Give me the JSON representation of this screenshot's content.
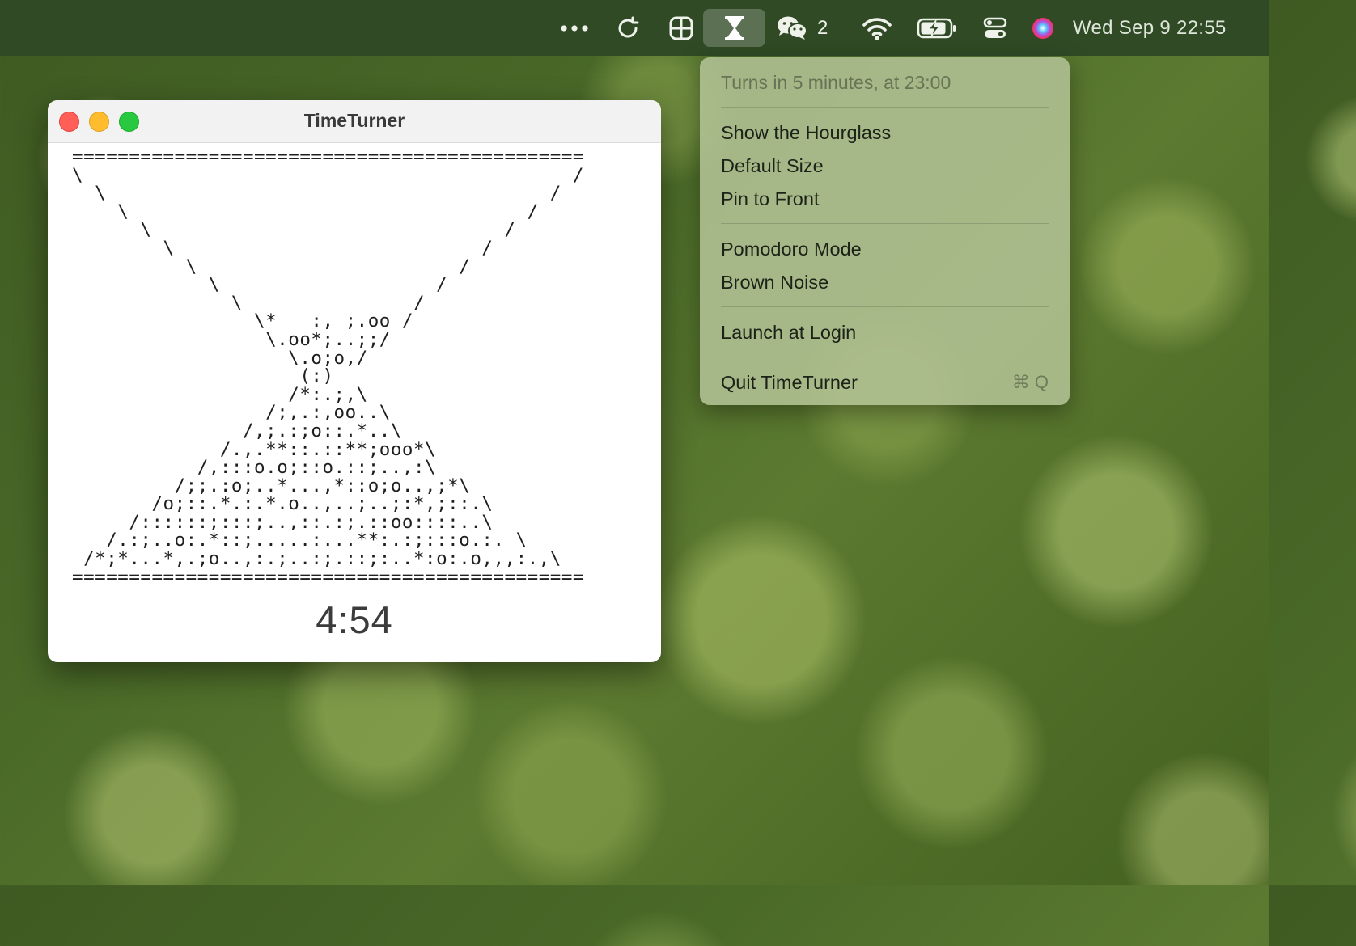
{
  "menubar": {
    "icons": [
      "more-icon",
      "refresh-icon",
      "grid-icon",
      "hourglass-icon",
      "wechat-icon",
      "wifi-icon",
      "battery-icon",
      "control-center-icon",
      "siri-icon"
    ],
    "wechat_badge": "2",
    "clock": "Wed Sep 9  22:55"
  },
  "menu": {
    "info": "Turns in 5 minutes, at 23:00",
    "show_hourglass": "Show the Hourglass",
    "default_size": "Default Size",
    "pin_to_front": "Pin to Front",
    "pomodoro_mode": "Pomodoro Mode",
    "brown_noise": "Brown Noise",
    "launch_at_login": "Launch at Login",
    "quit": "Quit TimeTurner",
    "quit_shortcut": "⌘ Q"
  },
  "window": {
    "title": "TimeTurner",
    "hourglass_ascii": "=============================================\n\\                                           /\n  \\                                       /\n    \\                                   /\n      \\                               /\n        \\                           /\n          \\                       /\n            \\                   /\n              \\               /\n                \\*   :, ;.oo /\n                 \\.oo*;..;;/\n                   \\.o;o,/\n                    (:)\n                   /*:.;,\\\n                 /;,.:,oo..\\\n               /,;.:;o::.*..\\\n             /.,.**::.::**;ooo*\\\n           /,:::o.o;::o.::;..,:\\\n         /;;.:o;..*...,*::o;o..,;*\\\n       /o;::.*.:.*.o..,..;..;:*,;::.\\\n     /::::::;:::;..,::.:;.::oo::::..\\\n   /.:;..o:.*::;.....:...**:.:;:::o.:. \\\n /*;*...*,.;o..,:.;..:;.::;:..*:o:.o,,,:.,\\\n=============================================",
    "timer": "4:54"
  },
  "colors": {
    "menubar_bg": "#2f4a25",
    "close": "#ff5f57",
    "minimize": "#febc2e",
    "zoom": "#28c840"
  }
}
